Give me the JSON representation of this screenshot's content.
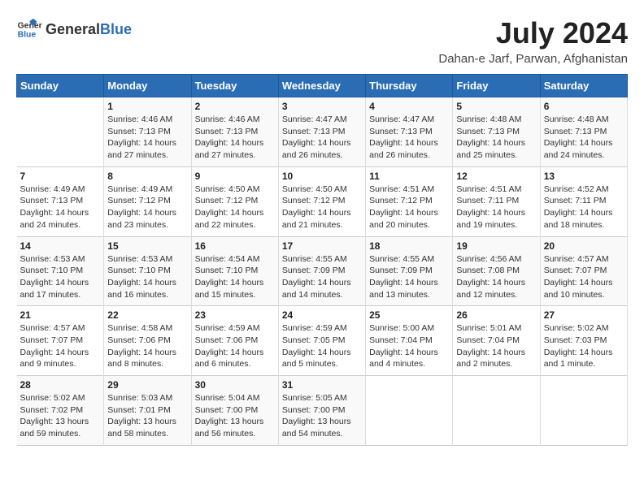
{
  "header": {
    "logo_general": "General",
    "logo_blue": "Blue",
    "month_year": "July 2024",
    "location": "Dahan-e Jarf, Parwan, Afghanistan"
  },
  "days_of_week": [
    "Sunday",
    "Monday",
    "Tuesday",
    "Wednesday",
    "Thursday",
    "Friday",
    "Saturday"
  ],
  "weeks": [
    [
      {
        "day": "",
        "detail": ""
      },
      {
        "day": "1",
        "detail": "Sunrise: 4:46 AM\nSunset: 7:13 PM\nDaylight: 14 hours\nand 27 minutes."
      },
      {
        "day": "2",
        "detail": "Sunrise: 4:46 AM\nSunset: 7:13 PM\nDaylight: 14 hours\nand 27 minutes."
      },
      {
        "day": "3",
        "detail": "Sunrise: 4:47 AM\nSunset: 7:13 PM\nDaylight: 14 hours\nand 26 minutes."
      },
      {
        "day": "4",
        "detail": "Sunrise: 4:47 AM\nSunset: 7:13 PM\nDaylight: 14 hours\nand 26 minutes."
      },
      {
        "day": "5",
        "detail": "Sunrise: 4:48 AM\nSunset: 7:13 PM\nDaylight: 14 hours\nand 25 minutes."
      },
      {
        "day": "6",
        "detail": "Sunrise: 4:48 AM\nSunset: 7:13 PM\nDaylight: 14 hours\nand 24 minutes."
      }
    ],
    [
      {
        "day": "7",
        "detail": "Sunrise: 4:49 AM\nSunset: 7:13 PM\nDaylight: 14 hours\nand 24 minutes."
      },
      {
        "day": "8",
        "detail": "Sunrise: 4:49 AM\nSunset: 7:12 PM\nDaylight: 14 hours\nand 23 minutes."
      },
      {
        "day": "9",
        "detail": "Sunrise: 4:50 AM\nSunset: 7:12 PM\nDaylight: 14 hours\nand 22 minutes."
      },
      {
        "day": "10",
        "detail": "Sunrise: 4:50 AM\nSunset: 7:12 PM\nDaylight: 14 hours\nand 21 minutes."
      },
      {
        "day": "11",
        "detail": "Sunrise: 4:51 AM\nSunset: 7:12 PM\nDaylight: 14 hours\nand 20 minutes."
      },
      {
        "day": "12",
        "detail": "Sunrise: 4:51 AM\nSunset: 7:11 PM\nDaylight: 14 hours\nand 19 minutes."
      },
      {
        "day": "13",
        "detail": "Sunrise: 4:52 AM\nSunset: 7:11 PM\nDaylight: 14 hours\nand 18 minutes."
      }
    ],
    [
      {
        "day": "14",
        "detail": "Sunrise: 4:53 AM\nSunset: 7:10 PM\nDaylight: 14 hours\nand 17 minutes."
      },
      {
        "day": "15",
        "detail": "Sunrise: 4:53 AM\nSunset: 7:10 PM\nDaylight: 14 hours\nand 16 minutes."
      },
      {
        "day": "16",
        "detail": "Sunrise: 4:54 AM\nSunset: 7:10 PM\nDaylight: 14 hours\nand 15 minutes."
      },
      {
        "day": "17",
        "detail": "Sunrise: 4:55 AM\nSunset: 7:09 PM\nDaylight: 14 hours\nand 14 minutes."
      },
      {
        "day": "18",
        "detail": "Sunrise: 4:55 AM\nSunset: 7:09 PM\nDaylight: 14 hours\nand 13 minutes."
      },
      {
        "day": "19",
        "detail": "Sunrise: 4:56 AM\nSunset: 7:08 PM\nDaylight: 14 hours\nand 12 minutes."
      },
      {
        "day": "20",
        "detail": "Sunrise: 4:57 AM\nSunset: 7:07 PM\nDaylight: 14 hours\nand 10 minutes."
      }
    ],
    [
      {
        "day": "21",
        "detail": "Sunrise: 4:57 AM\nSunset: 7:07 PM\nDaylight: 14 hours\nand 9 minutes."
      },
      {
        "day": "22",
        "detail": "Sunrise: 4:58 AM\nSunset: 7:06 PM\nDaylight: 14 hours\nand 8 minutes."
      },
      {
        "day": "23",
        "detail": "Sunrise: 4:59 AM\nSunset: 7:06 PM\nDaylight: 14 hours\nand 6 minutes."
      },
      {
        "day": "24",
        "detail": "Sunrise: 4:59 AM\nSunset: 7:05 PM\nDaylight: 14 hours\nand 5 minutes."
      },
      {
        "day": "25",
        "detail": "Sunrise: 5:00 AM\nSunset: 7:04 PM\nDaylight: 14 hours\nand 4 minutes."
      },
      {
        "day": "26",
        "detail": "Sunrise: 5:01 AM\nSunset: 7:04 PM\nDaylight: 14 hours\nand 2 minutes."
      },
      {
        "day": "27",
        "detail": "Sunrise: 5:02 AM\nSunset: 7:03 PM\nDaylight: 14 hours\nand 1 minute."
      }
    ],
    [
      {
        "day": "28",
        "detail": "Sunrise: 5:02 AM\nSunset: 7:02 PM\nDaylight: 13 hours\nand 59 minutes."
      },
      {
        "day": "29",
        "detail": "Sunrise: 5:03 AM\nSunset: 7:01 PM\nDaylight: 13 hours\nand 58 minutes."
      },
      {
        "day": "30",
        "detail": "Sunrise: 5:04 AM\nSunset: 7:00 PM\nDaylight: 13 hours\nand 56 minutes."
      },
      {
        "day": "31",
        "detail": "Sunrise: 5:05 AM\nSunset: 7:00 PM\nDaylight: 13 hours\nand 54 minutes."
      },
      {
        "day": "",
        "detail": ""
      },
      {
        "day": "",
        "detail": ""
      },
      {
        "day": "",
        "detail": ""
      }
    ]
  ]
}
